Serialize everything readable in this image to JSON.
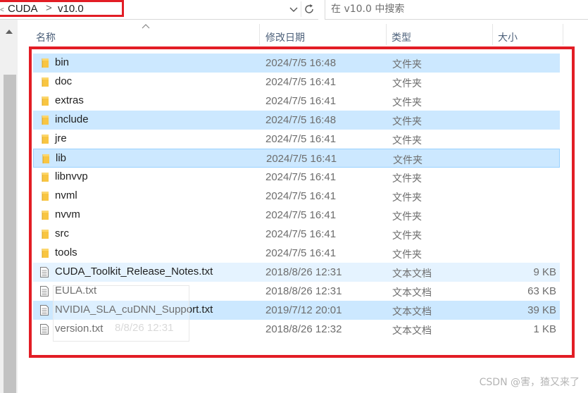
{
  "address": {
    "crumbs": [
      "CUDA",
      "v10.0"
    ],
    "separator": ">"
  },
  "search": {
    "placeholder": "在 v10.0 中搜索"
  },
  "columns": {
    "name": "名称",
    "modified": "修改日期",
    "type": "类型",
    "size": "大小"
  },
  "files": [
    {
      "name": "bin",
      "date": "2024/7/5 16:48",
      "type": "文件夹",
      "size": "",
      "kind": "folder",
      "state": "sel"
    },
    {
      "name": "doc",
      "date": "2024/7/5 16:41",
      "type": "文件夹",
      "size": "",
      "kind": "folder",
      "state": ""
    },
    {
      "name": "extras",
      "date": "2024/7/5 16:41",
      "type": "文件夹",
      "size": "",
      "kind": "folder",
      "state": ""
    },
    {
      "name": "include",
      "date": "2024/7/5 16:48",
      "type": "文件夹",
      "size": "",
      "kind": "folder",
      "state": "sel"
    },
    {
      "name": "jre",
      "date": "2024/7/5 16:41",
      "type": "文件夹",
      "size": "",
      "kind": "folder",
      "state": ""
    },
    {
      "name": "lib",
      "date": "2024/7/5 16:41",
      "type": "文件夹",
      "size": "",
      "kind": "folder",
      "state": "focus"
    },
    {
      "name": "libnvvp",
      "date": "2024/7/5 16:41",
      "type": "文件夹",
      "size": "",
      "kind": "folder",
      "state": ""
    },
    {
      "name": "nvml",
      "date": "2024/7/5 16:41",
      "type": "文件夹",
      "size": "",
      "kind": "folder",
      "state": ""
    },
    {
      "name": "nvvm",
      "date": "2024/7/5 16:41",
      "type": "文件夹",
      "size": "",
      "kind": "folder",
      "state": ""
    },
    {
      "name": "src",
      "date": "2024/7/5 16:41",
      "type": "文件夹",
      "size": "",
      "kind": "folder",
      "state": ""
    },
    {
      "name": "tools",
      "date": "2024/7/5 16:41",
      "type": "文件夹",
      "size": "",
      "kind": "folder",
      "state": ""
    },
    {
      "name": "CUDA_Toolkit_Release_Notes.txt",
      "date": "2018/8/26 12:31",
      "type": "文本文档",
      "size": "9 KB",
      "kind": "file",
      "state": "hover"
    },
    {
      "name": "EULA.txt",
      "date": "2018/8/26 12:31",
      "type": "文本文档",
      "size": "63 KB",
      "kind": "file",
      "state": ""
    },
    {
      "name": "NVIDIA_SLA_cuDNN_Support.txt",
      "date": "2019/7/12 20:01",
      "type": "文本文档",
      "size": "39 KB",
      "kind": "file",
      "state": "sel"
    },
    {
      "name": "version.txt",
      "date": "2018/8/26 12:32",
      "type": "文本文档",
      "size": "1 KB",
      "kind": "file",
      "state": ""
    }
  ],
  "ghost": {
    "date_fragment": "8/8/26 12:31"
  },
  "watermark": "CSDN @害，猹又来了",
  "colors": {
    "selection": "#cce8ff",
    "focus_border": "#99d1ff",
    "hover": "#e5f3ff",
    "annotation_red": "#e21d25",
    "folder": "#f8c542"
  },
  "icons": {
    "folder": "folder-icon",
    "file": "text-file-icon",
    "dropdown": "chevron-down-icon",
    "refresh": "refresh-icon",
    "sort": "sort-ascending-icon"
  }
}
